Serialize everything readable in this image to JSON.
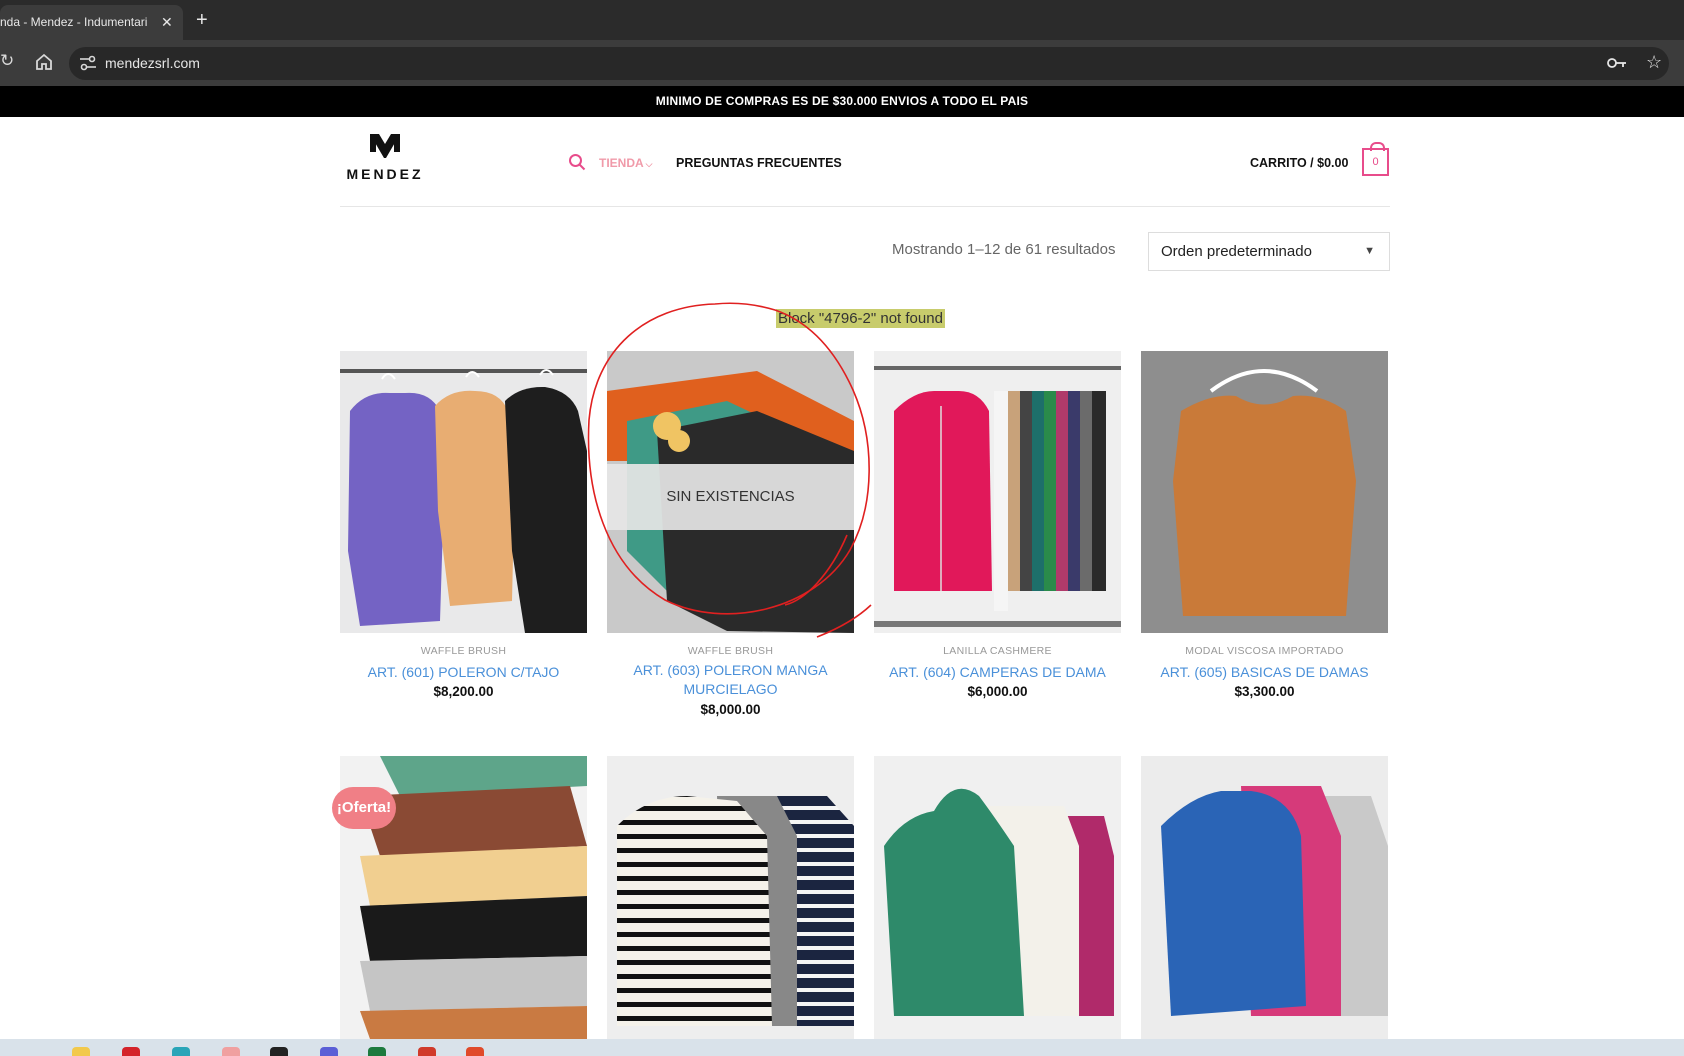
{
  "browser": {
    "tab_title": "nda - Mendez - Indumentari",
    "tab_close": "✕",
    "new_tab": "+",
    "url": "mendezsrl.com",
    "reload": "↻",
    "star": "☆"
  },
  "announcement": "MINIMO DE COMPRAS ES DE $30.000 ENVIOS A TODO EL PAIS",
  "header": {
    "logo_text": "MENDEZ",
    "nav": {
      "tienda": "TIENDA",
      "faq": "PREGUNTAS FRECUENTES"
    },
    "cart_label": "CARRITO / $0.00",
    "cart_count": "0"
  },
  "shop": {
    "result_count": "Mostrando 1–12 de 61 resultados",
    "order_selected": "Orden predeterminado",
    "block_warning": "Block \"4796-2\" not found",
    "out_of_stock_label": "SIN EXISTENCIAS",
    "sale_badge": "¡Oferta!"
  },
  "products": [
    {
      "category": "WAFFLE BRUSH",
      "name": "ART. (601) POLERON C/TAJO",
      "price": "$8,200.00"
    },
    {
      "category": "WAFFLE BRUSH",
      "name": "ART. (603) POLERON MANGA MURCIELAGO",
      "price": "$8,000.00"
    },
    {
      "category": "LANILLA CASHMERE",
      "name": "ART. (604) CAMPERAS DE DAMA",
      "price": "$6,000.00"
    },
    {
      "category": "MODAL VISCOSA IMPORTADO",
      "name": "ART. (605) BASICAS DE DAMAS",
      "price": "$3,300.00"
    }
  ],
  "colors": {
    "accent_pink": "#e84c8b",
    "link_blue": "#4a90d9",
    "announce_bg": "#000000",
    "annotation_red": "#e02020"
  }
}
